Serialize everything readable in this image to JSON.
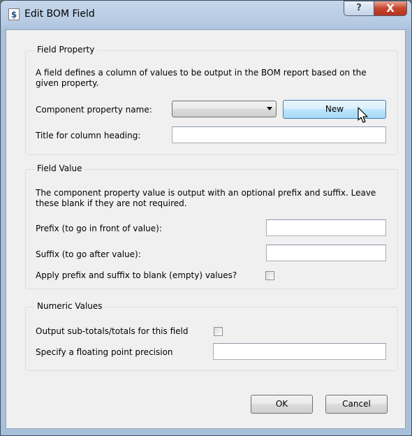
{
  "window": {
    "title": "Edit BOM Field",
    "help_label": "?",
    "close_label": "X",
    "app_icon_label": "$"
  },
  "field_property": {
    "legend": "Field Property",
    "description": "A field defines a column of values to be output in the BOM report based on the given property.",
    "component_label": "Component property name:",
    "component_value": "",
    "new_button": "New",
    "title_label": "Title for column heading:",
    "title_value": ""
  },
  "field_value": {
    "legend": "Field Value",
    "description": "The component property value is output with an optional prefix and suffix. Leave these blank if they are not required.",
    "prefix_label": "Prefix (to go in front of value):",
    "prefix_value": "",
    "suffix_label": "Suffix (to go after value):",
    "suffix_value": "",
    "apply_label": "Apply prefix and suffix to blank (empty) values?",
    "apply_checked": false
  },
  "numeric_values": {
    "legend": "Numeric Values",
    "subtotals_label": "Output sub-totals/totals for this field",
    "subtotals_checked": false,
    "precision_label": "Specify a floating point precision",
    "precision_value": ""
  },
  "buttons": {
    "ok": "OK",
    "cancel": "Cancel"
  },
  "icons": [
    "app-icon",
    "help-icon",
    "close-icon",
    "dropdown-arrow-icon",
    "mouse-pointer-icon"
  ]
}
